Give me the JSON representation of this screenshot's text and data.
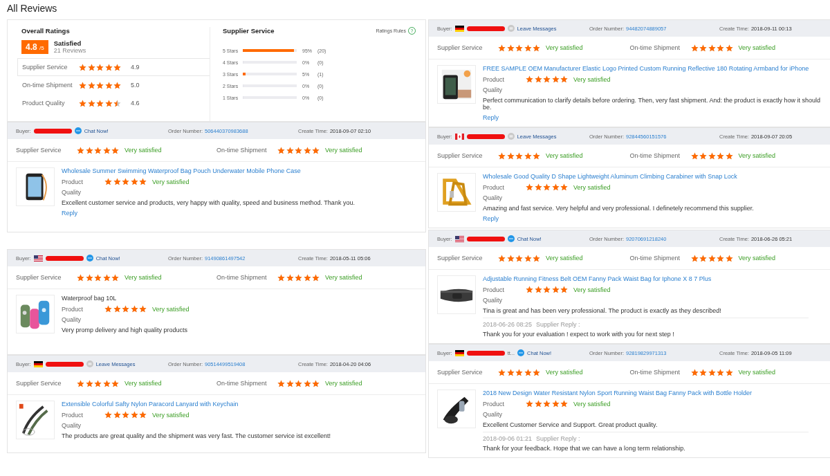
{
  "page_title": "All Reviews",
  "summary": {
    "title": "Overall Ratings",
    "score": "4.8",
    "out_of": "/5",
    "verdict": "Satisfied",
    "count": "21 Reviews",
    "ratings": [
      {
        "label": "Supplier Service",
        "stars": 5,
        "value": "4.9",
        "selected": true
      },
      {
        "label": "On-time Shipment",
        "stars": 5,
        "value": "5.0",
        "selected": false
      },
      {
        "label": "Product Quality",
        "stars": 4.5,
        "value": "4.6",
        "selected": false
      }
    ],
    "breakdown_title": "Supplier Service",
    "rules_link": "Ratings Rules",
    "rules_icon": "?",
    "distribution": [
      {
        "label": "5 Stars",
        "level": 0.95,
        "percent": "95%",
        "count": "(20)"
      },
      {
        "label": "4 Stars",
        "level": 0,
        "percent": "0%",
        "count": "(0)"
      },
      {
        "label": "3 Stars",
        "level": 0.05,
        "percent": "5%",
        "count": "(1)"
      },
      {
        "label": "2 Stars",
        "level": 0,
        "percent": "0%",
        "count": "(0)"
      },
      {
        "label": "1 Stars",
        "level": 0,
        "percent": "0%",
        "count": "(0)"
      }
    ]
  },
  "left_reviews": [
    {
      "buyer_label": "Buyer:",
      "contact": {
        "kind": "chat",
        "label": "Chat Now!"
      },
      "order_label": "Order Number:",
      "order_number": "506440370983688",
      "time_label": "Create Time:",
      "time": "2018-09-07 02:10",
      "ratings": [
        {
          "label": "Supplier Service",
          "stars": 5,
          "verdict": "Very satisfied"
        },
        {
          "label": "On-time Shipment",
          "stars": 5,
          "verdict": "Very satisfied"
        }
      ],
      "product": {
        "title": "Wholesale Summer Swimming Waterproof Bag Pouch Underwater Mobile Phone Case",
        "linked": true,
        "rating_label": "Product",
        "quality_label": "Quality",
        "stars": 5,
        "verdict": "Very satisfied"
      },
      "comment": "Excellent customer service and products, very happy with quality, speed and business method. Thank you.",
      "reply_link": "Reply"
    },
    {
      "buyer_label": "Buyer:",
      "flag": {
        "kind": "us"
      },
      "contact": {
        "kind": "chat",
        "label": "Chat Now!"
      },
      "order_label": "Order Number:",
      "order_number": "91490861497542",
      "time_label": "Create Time:",
      "time": "2018-05-11 05:06",
      "ratings": [
        {
          "label": "Supplier Service",
          "stars": 5,
          "verdict": "Very satisfied"
        },
        {
          "label": "On-time Shipment",
          "stars": 5,
          "verdict": "Very satisfied"
        }
      ],
      "product": {
        "title": "Waterproof bag 10L",
        "linked": false,
        "rating_label": "Product",
        "quality_label": "Quality",
        "stars": 5,
        "verdict": "Very satisfied"
      },
      "comment": "Very promp delivery and high quality products"
    },
    {
      "buyer_label": "Buyer:",
      "flag": {
        "kind": "de"
      },
      "contact": {
        "kind": "message",
        "label": "Leave Messages"
      },
      "order_label": "Order Number:",
      "order_number": "90514499519408",
      "time_label": "Create Time:",
      "time": "2018-04-20 04:06",
      "ratings": [
        {
          "label": "Supplier Service",
          "stars": 5,
          "verdict": "Very satisfied"
        },
        {
          "label": "On-time Shipment",
          "stars": 5,
          "verdict": "Very satisfied"
        }
      ],
      "product": {
        "title": "Extensible Colorful Safty Nylon Paracord Lanyard with Keychain",
        "linked": true,
        "rating_label": "Product",
        "quality_label": "Quality",
        "stars": 5,
        "verdict": "Very satisfied"
      },
      "comment": "The products are great quality and the shipment was very fast. The customer service ist excellent!"
    }
  ],
  "right_reviews": [
    {
      "buyer_label": "Buyer:",
      "flag": {
        "kind": "de"
      },
      "contact": {
        "kind": "message",
        "label": "Leave Messages"
      },
      "order_label": "Order Number:",
      "order_number": "94482074889057",
      "time_label": "Create Time:",
      "time": "2018-09-11 00:13",
      "ratings": [
        {
          "label": "Supplier Service",
          "stars": 5,
          "verdict": "Very satisfied"
        },
        {
          "label": "On-time Shipment",
          "stars": 5,
          "verdict": "Very satisfied"
        }
      ],
      "product": {
        "title": "FREE SAMPLE OEM Manufacturer Elastic Logo Printed Custom Running Reflective 180 Rotating Armband for iPhone",
        "linked": true,
        "rating_label": "Product",
        "quality_label": "Quality",
        "stars": 5,
        "verdict": "Very satisfied"
      },
      "comment": "Perfect communication to clarify details before ordering. Then, very fast shipment. And: the product is exactly how it should be.",
      "reply_link": "Reply"
    },
    {
      "buyer_label": "Buyer:",
      "flag": {
        "kind": "ca"
      },
      "contact": {
        "kind": "message",
        "label": "Leave Messages"
      },
      "order_label": "Order Number:",
      "order_number": "92844560151576",
      "time_label": "Create Time:",
      "time": "2018-09-07 20:05",
      "ratings": [
        {
          "label": "Supplier Service",
          "stars": 5,
          "verdict": "Very satisfied"
        },
        {
          "label": "On-time Shipment",
          "stars": 5,
          "verdict": "Very satisfied"
        }
      ],
      "product": {
        "title": "Wholesale Good Quality D Shape Lightweight Aluminum Climbing Carabiner with Snap Lock",
        "linked": true,
        "rating_label": "Product",
        "quality_label": "Quality",
        "stars": 5,
        "verdict": "Very satisfied"
      },
      "comment": "Amazing and fast service. Very helpful and very professional. I definetely recommend this supplier.",
      "reply_link": "Reply"
    },
    {
      "buyer_label": "Buyer:",
      "flag": {
        "kind": "us"
      },
      "contact": {
        "kind": "chat",
        "label": "Chat Now!"
      },
      "order_label": "Order Number:",
      "order_number": "92070691218240",
      "time_label": "Create Time:",
      "time": "2018-06-26 05:21",
      "ratings": [
        {
          "label": "Supplier Service",
          "stars": 5,
          "verdict": "Very satisfied"
        },
        {
          "label": "On-time Shipment",
          "stars": 5,
          "verdict": "Very satisfied"
        }
      ],
      "product": {
        "title": "Adjustable Running Fitness Belt OEM Fanny Pack Waist Bag for Iphone X 8 7 Plus",
        "linked": true,
        "rating_label": "Product",
        "quality_label": "Quality",
        "stars": 5,
        "verdict": "Very satisfied"
      },
      "comment": "Tina is great and has been very professional. The product is exactly as they described!",
      "supplier_reply": {
        "time": "2018-06-26 08:25",
        "label": "Supplier Reply :",
        "text": "Thank you for your evaluation ! expect to work with you for next step !"
      }
    },
    {
      "buyer_label": "Buyer:",
      "flag": {
        "kind": "de"
      },
      "name_tail": "tt...",
      "contact": {
        "kind": "chat",
        "label": "Chat Now!"
      },
      "order_label": "Order Number:",
      "order_number": "92819829971313",
      "time_label": "Create Time:",
      "time": "2018-09-05 11:09",
      "ratings": [
        {
          "label": "Supplier Service",
          "stars": 5,
          "verdict": "Very satisfied"
        },
        {
          "label": "On-time Shipment",
          "stars": 5,
          "verdict": "Very satisfied"
        }
      ],
      "product": {
        "title": "2018 New Design Water Resistant Nylon Sport Running Waist Bag Fanny Pack with Bottle Holder",
        "linked": true,
        "rating_label": "Product",
        "quality_label": "Quality",
        "stars": 5,
        "verdict": "Very satisfied"
      },
      "comment": "Excellent Customer Service and Support. Great product quality.",
      "supplier_reply": {
        "time": "2018-09-06 01:21",
        "label": "Supplier Reply :",
        "text": "Thank for your feedback. Hope that we can have a long term relationship."
      }
    }
  ]
}
